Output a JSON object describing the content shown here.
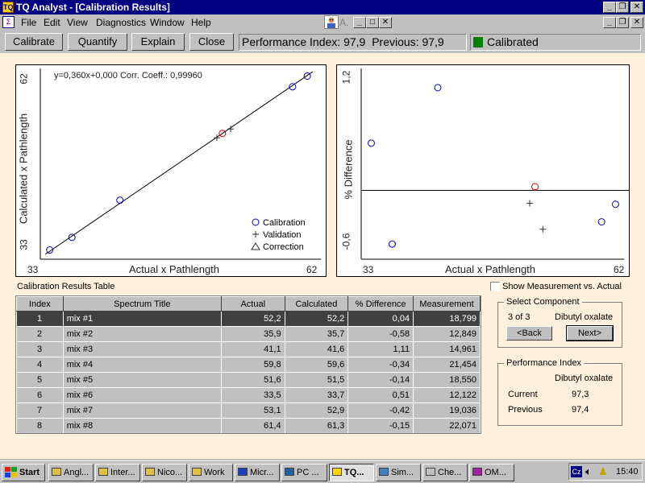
{
  "window": {
    "app_title": "TQ Analyst  - [Calibration Results]",
    "app_icon": "tq-app-icon"
  },
  "menu": [
    "File",
    "Edit",
    "View",
    "Diagnostics",
    "Window",
    "Help"
  ],
  "menu_right_label": "A.",
  "toolbar": {
    "buttons": [
      "Calibrate",
      "Quantify",
      "Explain",
      "Close"
    ],
    "perf_index_label": "Performance Index:",
    "perf_index_value": "97,9",
    "previous_label": "Previous:",
    "previous_value": "97,9",
    "status_text": "Calibrated",
    "status_color": "#008000"
  },
  "left_plot": {
    "equation": "y=0,360x+0,000 Corr. Coeff.: 0,99960",
    "xlabel": "Actual x Pathlength",
    "ylabel": "Calculated x Pathlength",
    "x_min_label": "33",
    "x_max_label": "62",
    "y_min_label": "33",
    "y_max_label": "62",
    "legend": [
      "Calibration",
      "Validation",
      "Correction"
    ]
  },
  "right_plot": {
    "xlabel": "Actual x Pathlength",
    "ylabel": "% Difference",
    "x_min_label": "33",
    "x_max_label": "62",
    "y_max_label": "1,2",
    "y_min_label": "-0,6"
  },
  "chart_data": [
    {
      "type": "scatter",
      "xlabel": "Actual x Pathlength",
      "ylabel": "Calculated x Pathlength",
      "xlim": [
        33,
        62
      ],
      "ylim": [
        33,
        62
      ],
      "annotation": "y=0,360x+0,000 Corr. Coeff.: 0,99960",
      "series": [
        {
          "name": "Calibration",
          "marker": "circle",
          "color": "#0000c0",
          "x": [
            33.5,
            35.9,
            41.1,
            59.8,
            61.4
          ],
          "y": [
            33.7,
            35.7,
            41.6,
            59.6,
            61.3
          ]
        },
        {
          "name": "Validation",
          "marker": "plus",
          "color": "#303030",
          "x": [
            51.6,
            53.1
          ],
          "y": [
            51.5,
            52.9
          ]
        },
        {
          "name": "",
          "marker": "circle",
          "color": "#d00000",
          "x": [
            52.2
          ],
          "y": [
            52.2
          ]
        }
      ],
      "fit_line": {
        "x": [
          33,
          62
        ],
        "y": [
          33,
          62
        ]
      }
    },
    {
      "type": "scatter",
      "xlabel": "Actual x Pathlength",
      "ylabel": "% Difference",
      "xlim": [
        33,
        62
      ],
      "ylim": [
        -0.7,
        1.3
      ],
      "zero_line": 0,
      "series": [
        {
          "name": "Calibration",
          "marker": "circle",
          "color": "#0000c0",
          "x": [
            33.5,
            35.9,
            41.1,
            59.8,
            61.4
          ],
          "y": [
            0.51,
            -0.58,
            1.11,
            -0.34,
            -0.15
          ]
        },
        {
          "name": "Validation",
          "marker": "plus",
          "color": "#303030",
          "x": [
            51.6,
            53.1
          ],
          "y": [
            -0.14,
            -0.42
          ]
        },
        {
          "name": "",
          "marker": "circle",
          "color": "#d00000",
          "x": [
            52.2
          ],
          "y": [
            0.04
          ]
        }
      ]
    }
  ],
  "table": {
    "caption": "Calibration Results Table",
    "columns": [
      "Index",
      "Spectrum Title",
      "Actual",
      "Calculated",
      "% Difference",
      "Measurement"
    ],
    "rows": [
      [
        "1",
        "mix #1",
        "52,2",
        "52,2",
        "0,04",
        "18,799"
      ],
      [
        "2",
        "mix #2",
        "35,9",
        "35,7",
        "-0,58",
        "12,849"
      ],
      [
        "3",
        "mix #3",
        "41,1",
        "41,6",
        "1,11",
        "14,961"
      ],
      [
        "4",
        "mix #4",
        "59,8",
        "59,6",
        "-0,34",
        "21,454"
      ],
      [
        "5",
        "mix #5",
        "51,6",
        "51,5",
        "-0,14",
        "18,550"
      ],
      [
        "6",
        "mix #6",
        "33,5",
        "33,7",
        "0,51",
        "12,122"
      ],
      [
        "7",
        "mix #7",
        "53,1",
        "52,9",
        "-0,42",
        "19,036"
      ],
      [
        "8",
        "mix #8",
        "61,4",
        "61,3",
        "-0,15",
        "22,071"
      ]
    ],
    "selected_row": 0
  },
  "show_measurement": {
    "label": "Show Measurement vs. Actual",
    "checked": false
  },
  "select_component": {
    "title": "Select Component",
    "count": "3 of 3",
    "component": "Dibutyl oxalate",
    "back_label": "<Back",
    "next_label": "Next>"
  },
  "perf_group": {
    "title": "Performance Index",
    "component": "Dibutyl oxalate",
    "current_label": "Current",
    "current_value": "97,3",
    "previous_label": "Previous",
    "previous_value": "97,4"
  },
  "taskbar": {
    "start_label": "Start",
    "tasks": [
      "Angl...",
      "Inter...",
      "Nico...",
      "Work",
      "Micr...",
      "PC ...",
      "TQ...",
      "Sim...",
      "Che...",
      "OM..."
    ],
    "active_task": 6,
    "lang": "Cz",
    "clock": "15:40"
  }
}
